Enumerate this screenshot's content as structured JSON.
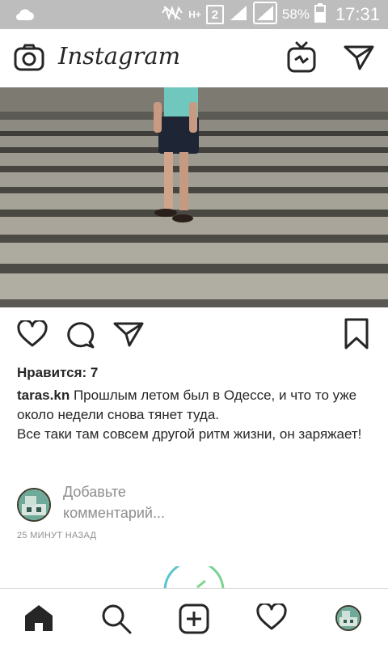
{
  "status_bar": {
    "network": "H+",
    "sim_slot": "2",
    "battery_percent": "58%",
    "time": "17:31"
  },
  "header": {
    "logo_text": "Instagram",
    "icons": [
      "camera-icon",
      "igtv-icon",
      "direct-message-icon"
    ]
  },
  "post": {
    "likes_text": "Нравится: 7",
    "username": "taras.kn",
    "caption_line1": "Прошлым летом был в Одессе, и что то уже около недели снова тянет туда.",
    "caption_line2": "Все таки там совсем другой ритм жизни, он заряжает!",
    "comment_placeholder": "Добавьте комментарий...",
    "timestamp": "25 МИНУТ НАЗАД"
  },
  "actions": [
    "like-icon",
    "comment-icon",
    "share-icon",
    "bookmark-icon"
  ],
  "bottom_nav": [
    "home-icon",
    "search-icon",
    "new-post-icon",
    "activity-icon",
    "profile-avatar"
  ],
  "colors": {
    "status_bar_bg": "#bdbdbd",
    "text": "#262626",
    "secondary_text": "#8e8e8e",
    "loader_green": "#7bd58b",
    "loader_teal": "#58c3d6"
  }
}
